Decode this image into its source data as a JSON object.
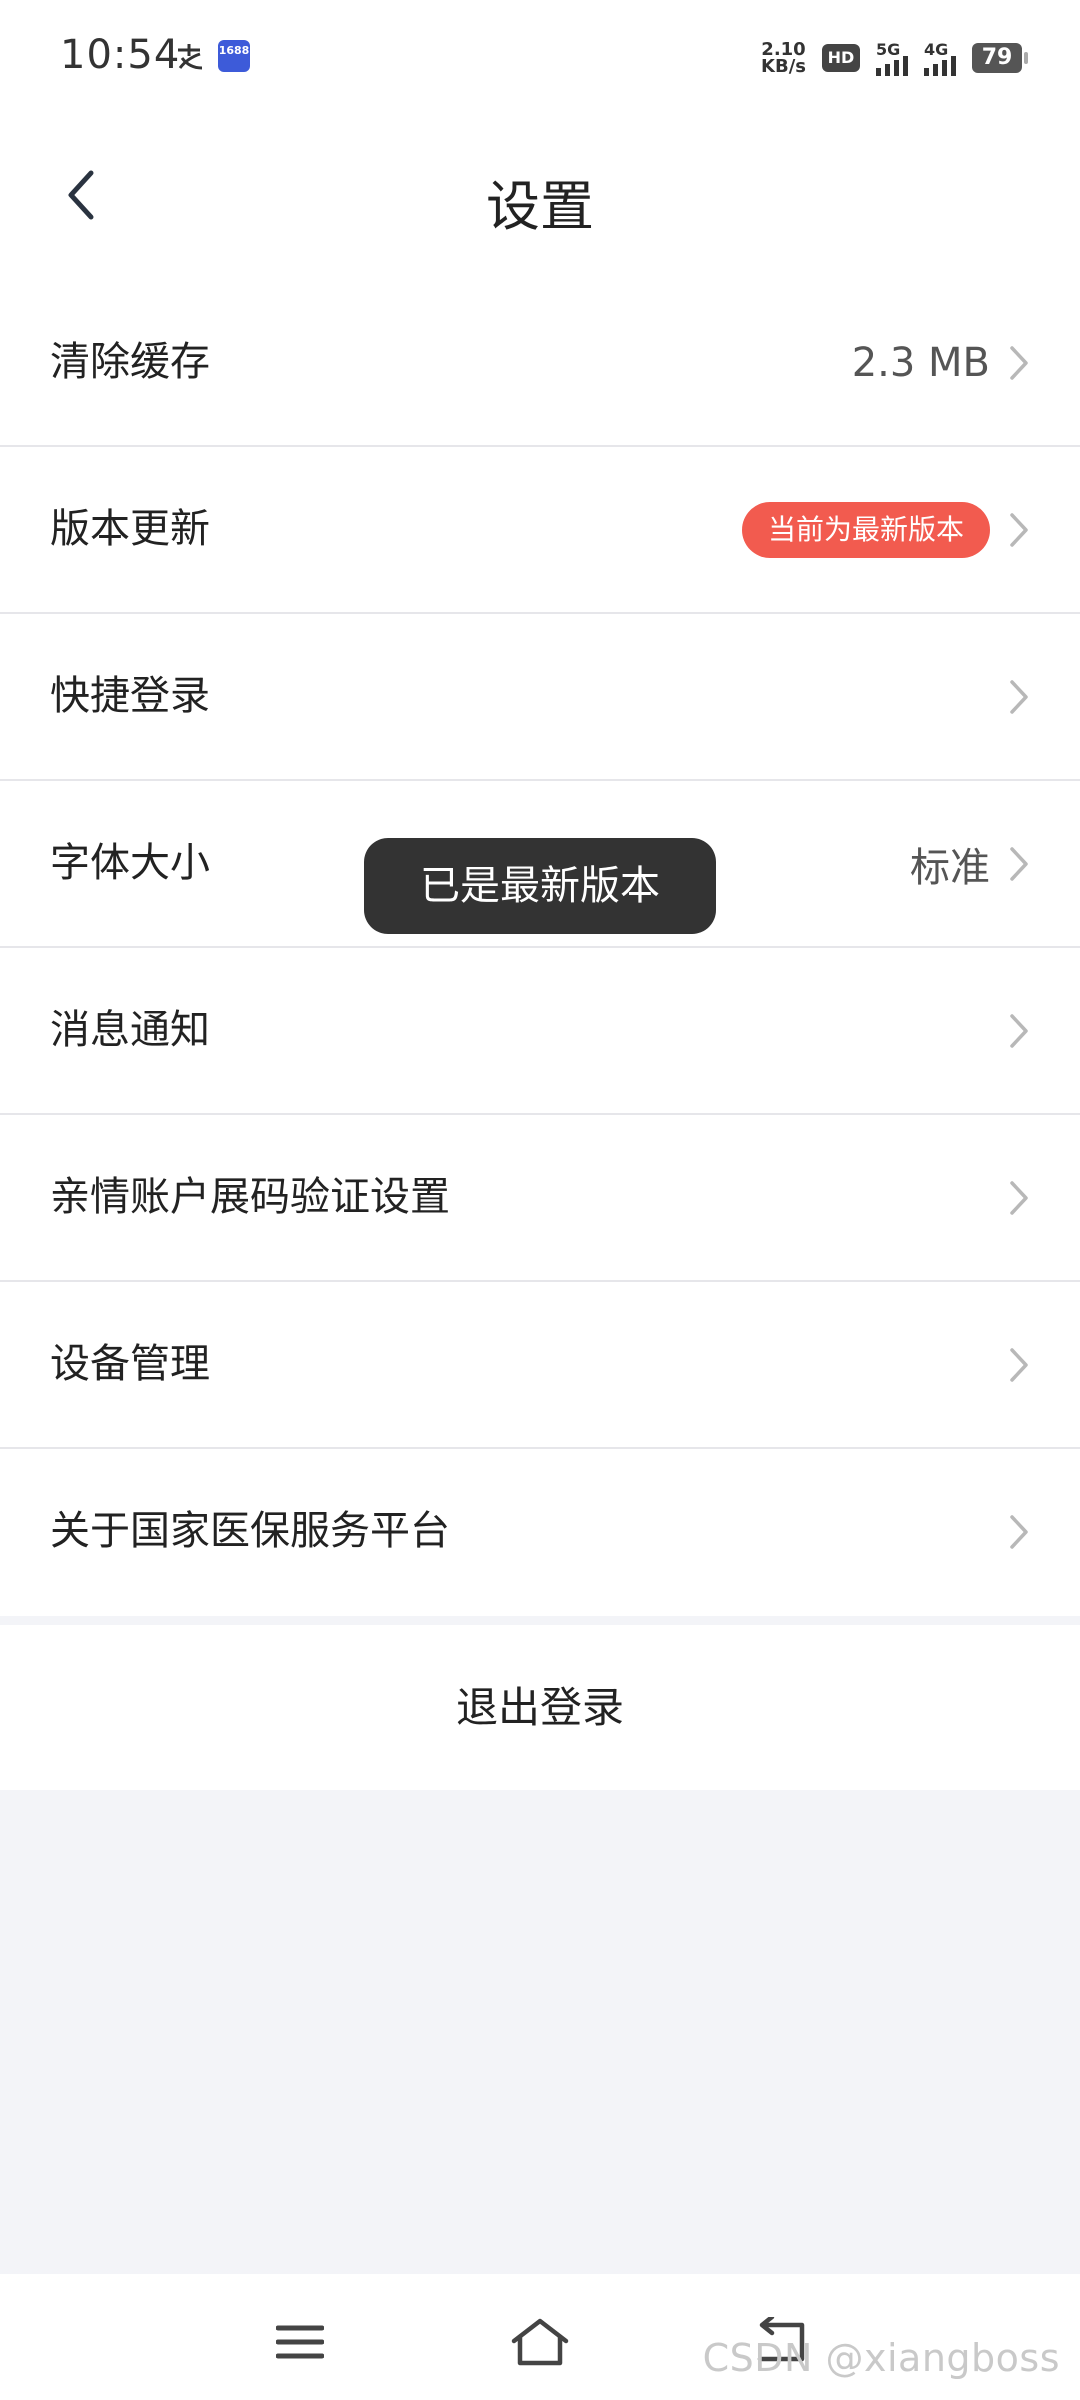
{
  "status_bar": {
    "time": "10:54",
    "app_icon_1688_text": "1688",
    "net_speed_value": "2.10",
    "net_speed_unit": "KB/s",
    "hd_label": "HD",
    "network_5g": "5G",
    "network_4g": "4G",
    "battery": "79"
  },
  "header": {
    "title": "设置",
    "back_icon": "chevron-left-icon"
  },
  "settings": {
    "items": [
      {
        "label": "清除缓存",
        "value": "2.3 MB"
      },
      {
        "label": "版本更新",
        "badge": "当前为最新版本"
      },
      {
        "label": "快捷登录"
      },
      {
        "label": "字体大小",
        "value": "标准"
      },
      {
        "label": "消息通知"
      },
      {
        "label": "亲情账户展码验证设置"
      },
      {
        "label": "设备管理"
      },
      {
        "label": "关于国家医保服务平台"
      }
    ]
  },
  "logout_label": "退出登录",
  "toast": {
    "message": "已是最新版本"
  },
  "nav": {
    "menu_icon": "menu-icon",
    "home_icon": "home-icon",
    "back_icon": "back-icon"
  },
  "watermark": "CSDN @xiangboss",
  "colors": {
    "badge": "#f25b4f",
    "toast_bg": "#333333",
    "page_bg": "#f3f4f8"
  }
}
